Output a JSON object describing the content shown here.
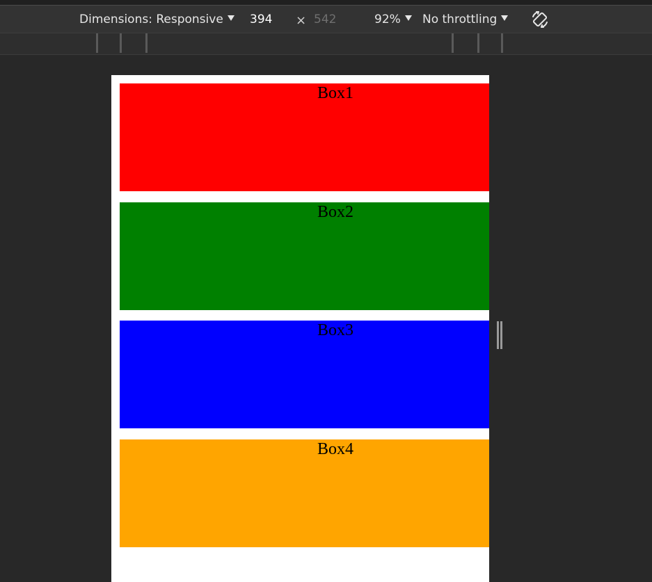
{
  "toolbar": {
    "dimensions_label": "Dimensions: Responsive",
    "width_value": "394",
    "times_symbol": "×",
    "height_placeholder": "542",
    "zoom_label": "92%",
    "throttling_label": "No throttling",
    "rotate_icon": "rotate-icon"
  },
  "page": {
    "boxes": [
      {
        "label": "Box1",
        "color": "#ff0000"
      },
      {
        "label": "Box2",
        "color": "#008000"
      },
      {
        "label": "Box3",
        "color": "#0000ff"
      },
      {
        "label": "Box4",
        "color": "#ffa500"
      }
    ]
  }
}
